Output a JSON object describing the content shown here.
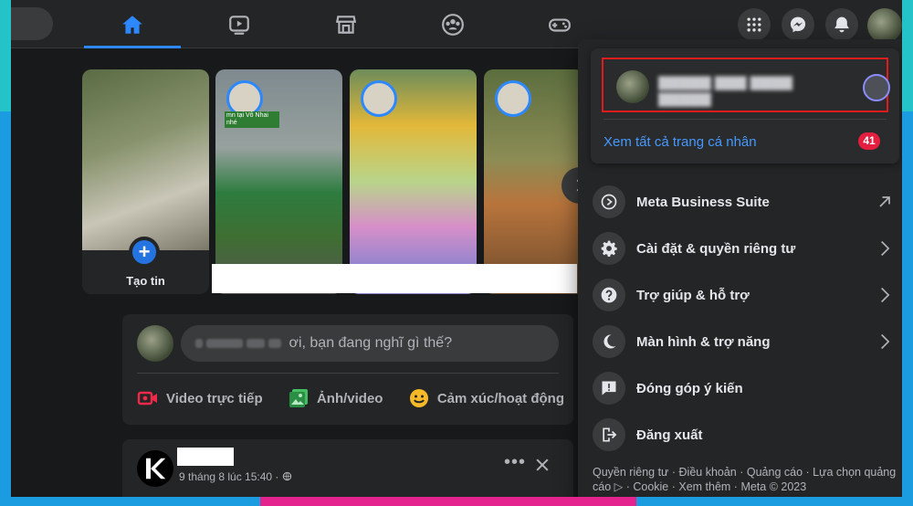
{
  "colors": {
    "accent": "#2d88ff",
    "link": "#4599ff",
    "badge": "#e41e3f",
    "highlight_box": "#e01b1b",
    "frame_teal": "#23c3c9",
    "frame_pink": "#e4238e",
    "frame_blue": "#1b9be0"
  },
  "nav": {
    "tabs": [
      {
        "icon": "home-icon",
        "active": true
      },
      {
        "icon": "watch-icon",
        "active": false
      },
      {
        "icon": "marketplace-icon",
        "active": false
      },
      {
        "icon": "groups-icon",
        "active": false
      },
      {
        "icon": "gaming-icon",
        "active": false
      }
    ],
    "right_buttons": [
      "menu-grid-icon",
      "messenger-icon",
      "notifications-icon"
    ]
  },
  "stories": {
    "create_label": "Tạo tin",
    "items": [
      {
        "caption": "mn tại Vô Nhai nhé"
      },
      {
        "caption": ""
      },
      {
        "caption": ""
      }
    ]
  },
  "composer": {
    "prompt": "ơi, bạn đang nghĩ gì thế?",
    "actions": [
      {
        "label": "Video trực tiếp",
        "icon": "live-video-icon",
        "color": "#f02849"
      },
      {
        "label": "Ảnh/video",
        "icon": "photo-icon",
        "color": "#45bd62"
      },
      {
        "label": "Cảm xúc/hoạt động",
        "icon": "feeling-icon",
        "color": "#f7b928"
      }
    ]
  },
  "post": {
    "meta": "9 tháng 8 lúc 15:40 ·"
  },
  "account_menu": {
    "see_all_profiles": "Xem tất cả trang cá nhân",
    "profile_count": "41",
    "items": [
      {
        "label": "Meta Business Suite",
        "icon": "business-suite-icon",
        "trail": "external"
      },
      {
        "label": "Cài đặt & quyền riêng tư",
        "icon": "settings-gear-icon",
        "trail": "chevron"
      },
      {
        "label": "Trợ giúp & hỗ trợ",
        "icon": "help-icon",
        "trail": "chevron"
      },
      {
        "label": "Màn hình & trợ năng",
        "icon": "moon-icon",
        "trail": "chevron"
      },
      {
        "label": "Đóng góp ý kiến",
        "icon": "feedback-icon",
        "trail": ""
      },
      {
        "label": "Đăng xuất",
        "icon": "logout-icon",
        "trail": ""
      }
    ],
    "footer": "Quyền riêng tư · Điều khoản · Quảng cáo · Lựa chọn quảng cáo ▷ · Cookie · Xem thêm · Meta © 2023"
  }
}
